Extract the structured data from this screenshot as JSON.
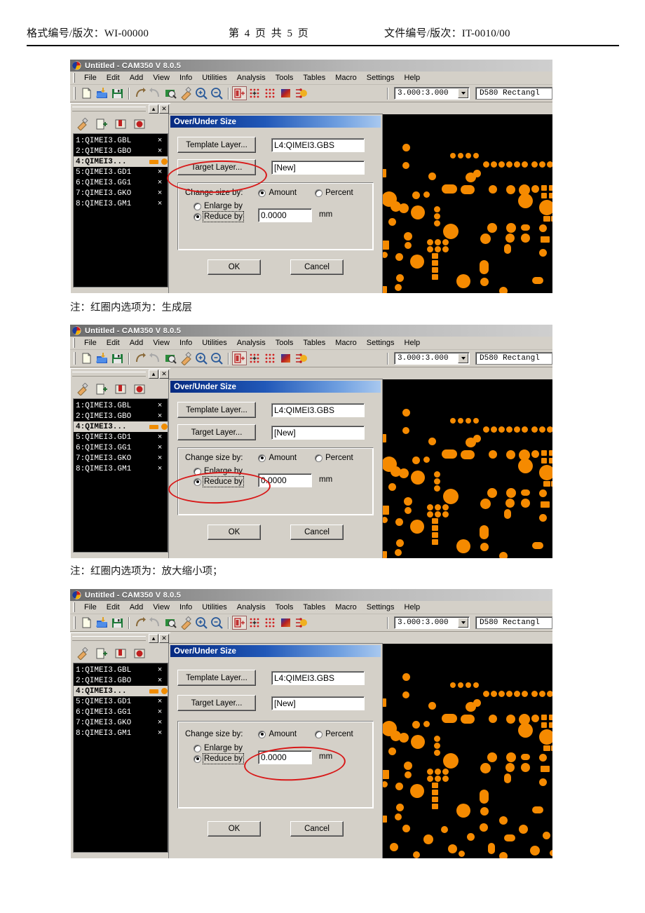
{
  "document_header": {
    "left": "格式编号/版次：WI-00000",
    "middle": "第 4 页 共 5 页",
    "right": "文件编号/版次：IT-0010/00"
  },
  "captions": [
    {
      "text": "注：红圈内选项为：生成层"
    },
    {
      "text": "注：红圈内选项为：放大缩小项；"
    }
  ],
  "app": {
    "window_title": "Untitled - CAM350 V 8.0.5",
    "menu": [
      {
        "label": "File",
        "accel": "F"
      },
      {
        "label": "Edit",
        "accel": "E"
      },
      {
        "label": "Add",
        "accel": "A"
      },
      {
        "label": "View",
        "accel": "V"
      },
      {
        "label": "Info",
        "accel": "I"
      },
      {
        "label": "Utilities",
        "accel": "U"
      },
      {
        "label": "Analysis",
        "accel": "n"
      },
      {
        "label": "Tools",
        "accel": "o"
      },
      {
        "label": "Tables",
        "accel": "T"
      },
      {
        "label": "Macro",
        "accel": "M"
      },
      {
        "label": "Settings",
        "accel": "S"
      },
      {
        "label": "Help",
        "accel": "H"
      }
    ],
    "toolbar": {
      "icons": [
        "new-file-icon",
        "open-folder-icon",
        "save-disk-icon",
        "undo-arrow-icon",
        "redo-arrow-icon",
        "query-icon",
        "paint-brush-icon",
        "zoom-in-icon",
        "zoom-out-icon",
        "select-layer-icon",
        "dot-grid-sparse-icon",
        "dot-grid-dense-icon",
        "color-palette-icon",
        "nets-icon"
      ],
      "zoom_value": "3.000:3.000",
      "dcode_value": "D580   Rectangl"
    }
  },
  "layer_panel": {
    "title_buttons": [
      "minimize-button",
      "close-button"
    ],
    "tools": [
      "layer-paint-icon",
      "layer-add-icon",
      "layer-book-icon",
      "layer-stop-icon"
    ],
    "rows": [
      {
        "name": "1:QIMEI3.GBL",
        "mark": "×",
        "selected": false
      },
      {
        "name": "2:QIMEI3.GBO",
        "mark": "×",
        "selected": false
      },
      {
        "name": "4:QIMEI3...",
        "mark": "",
        "selected": true
      },
      {
        "name": "5:QIMEI3.GD1",
        "mark": "×",
        "selected": false
      },
      {
        "name": "6:QIMEI3.GG1",
        "mark": "×",
        "selected": false
      },
      {
        "name": "7:QIMEI3.GKO",
        "mark": "×",
        "selected": false
      },
      {
        "name": "8:QIMEI3.GM1",
        "mark": "×",
        "selected": false
      }
    ]
  },
  "dialog": {
    "title": "Over/Under Size",
    "template_layer_button": "Template Layer...",
    "template_layer_value": "L4:QIMEI3.GBS",
    "target_layer_button": "Target Layer...",
    "target_layer_value": "[New]",
    "change_size_label": "Change size by:",
    "amount_radio": "Amount",
    "percent_radio": "Percent",
    "enlarge_radio": "Enlarge by",
    "reduce_radio": "Reduce by",
    "amount_value": "0.0000",
    "unit_label": "mm",
    "ok_button": "OK",
    "cancel_button": "Cancel",
    "selected_change_size": "Amount",
    "selected_direction": "Reduce by"
  },
  "annotations": [
    {
      "target": "target-layer-button",
      "shape": "ellipse",
      "color": "#d81919"
    },
    {
      "target": "enlarge-reduce-group",
      "shape": "ellipse",
      "color": "#d81919"
    },
    {
      "target": "amount-input",
      "shape": "ellipse",
      "color": "#d81919"
    }
  ],
  "colors": {
    "pcb_background": "#000000",
    "pad": "#f58a00",
    "dialog_face": "#d4d0c8",
    "dialog_title_start": "#062a80",
    "annotation_red": "#d81919"
  }
}
